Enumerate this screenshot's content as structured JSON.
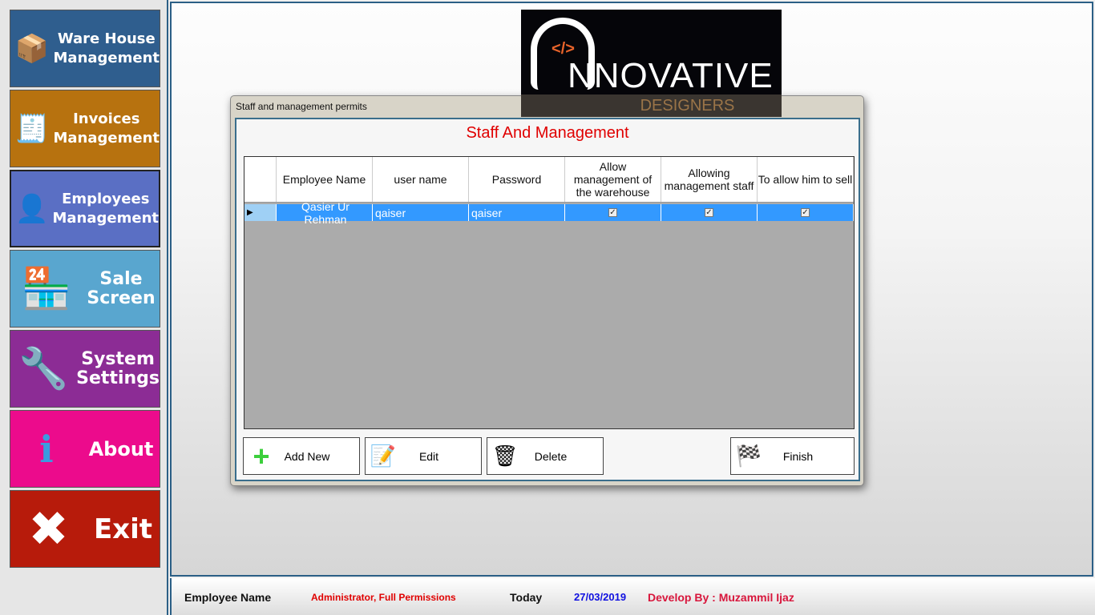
{
  "sidebar": {
    "items": [
      {
        "label": "Ware House Management",
        "icon": "box-icon",
        "color": "#2f5e8e"
      },
      {
        "label": "Invoices Management",
        "icon": "invoice-icon",
        "color": "#b7720f"
      },
      {
        "label": "Employees Management",
        "icon": "user-icon",
        "color": "#5a6fc4"
      },
      {
        "label": "Sale Screen",
        "icon": "shop-icon",
        "color": "#59a6cf"
      },
      {
        "label": "System Settings",
        "icon": "tools-icon",
        "color": "#8c2c95"
      },
      {
        "label": "About",
        "icon": "info-icon",
        "color": "#ec0b8c"
      },
      {
        "label": "Exit",
        "icon": "close-icon",
        "color": "#b71b0b"
      }
    ]
  },
  "logo": {
    "text": "NNOVATIVE",
    "code": "</>",
    "sub": "DESIGNERS"
  },
  "dialog": {
    "title": "Staff and management permits",
    "heading": "Staff And Management",
    "columns": [
      "Employee Name",
      "user name",
      "Password",
      "Allow management of the warehouse",
      "Allowing management staff",
      "To allow him to sell"
    ],
    "rows": [
      {
        "name": "Qasier Ur Rehman",
        "user": "qaiser",
        "password": "qaiser",
        "warehouse": true,
        "staff": true,
        "sell": true
      }
    ],
    "buttons": {
      "add": "Add New",
      "edit": "Edit",
      "delete": "Delete",
      "finish": "Finish"
    }
  },
  "footer": {
    "employee_label": "Employee Name",
    "employee_value": "Administrator, Full Permissions",
    "today_label": "Today",
    "date": "27/03/2019",
    "developer": "Develop By : Muzammil Ijaz"
  }
}
